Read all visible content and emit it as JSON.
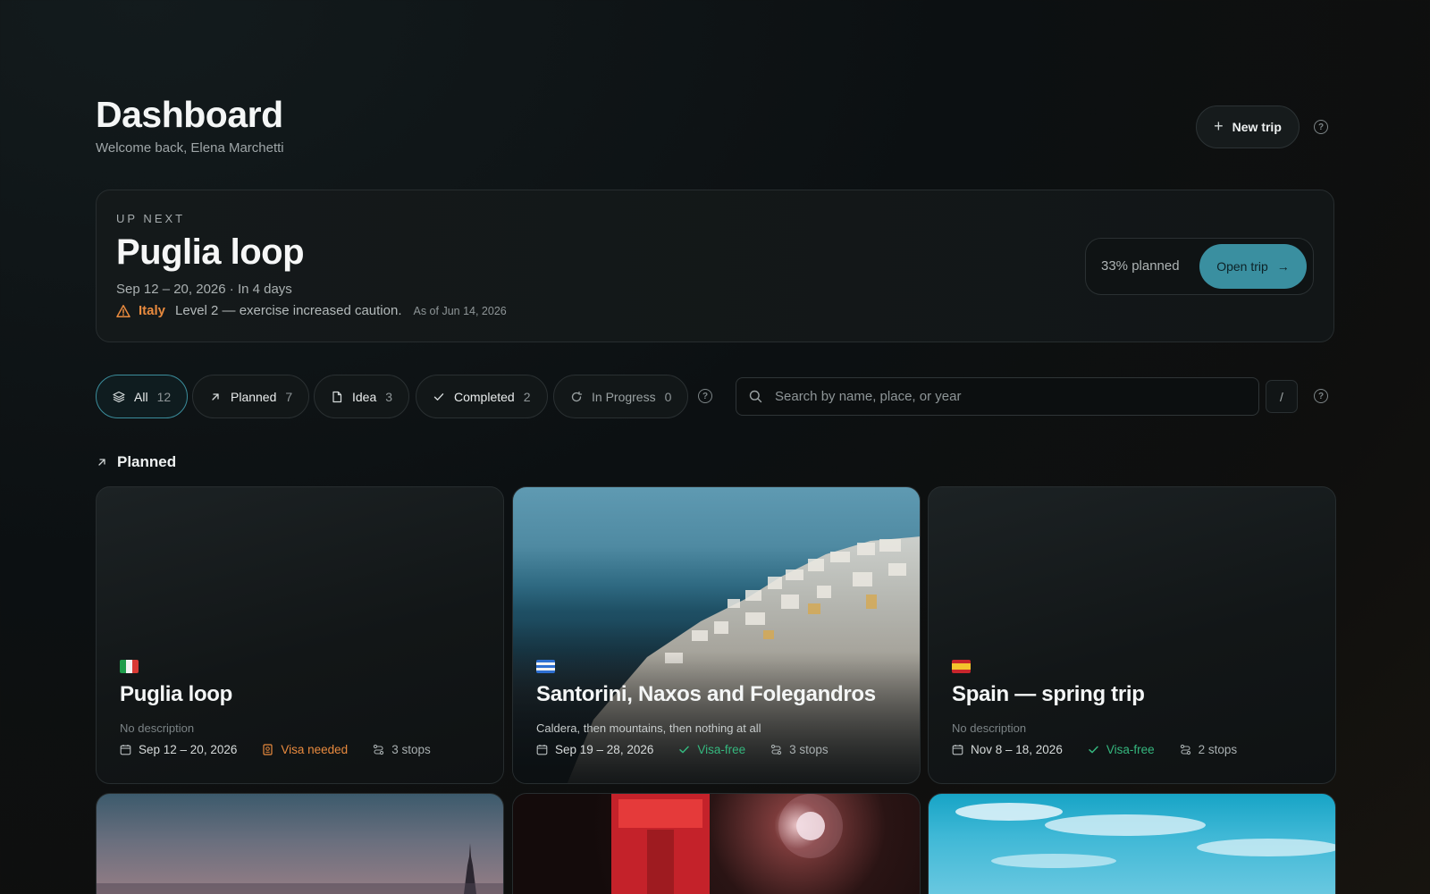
{
  "header": {
    "title": "Dashboard",
    "welcome": "Welcome back, Elena Marchetti",
    "new_trip_label": "New trip",
    "plus_icon": "plus-icon",
    "help_icon": "help-icon"
  },
  "up_next": {
    "label": "UP NEXT",
    "title": "Puglia loop",
    "dates": "Sep 12 – 20, 2026 · In 4 days",
    "advisory": {
      "country": "Italy",
      "level_text": "Level 2 — exercise increased caution.",
      "as_of": "As of Jun 14, 2026",
      "icon": "warning-icon"
    },
    "progress_text": "33% planned",
    "progress_percent": 33,
    "open_trip_label": "Open trip"
  },
  "filters": [
    {
      "label": "All",
      "count": "12",
      "icon": "layers-icon",
      "active": true
    },
    {
      "label": "Planned",
      "count": "7",
      "icon": "arrow-up-right-icon"
    },
    {
      "label": "Idea",
      "count": "3",
      "icon": "document-icon"
    },
    {
      "label": "Completed",
      "count": "2",
      "icon": "check-icon"
    },
    {
      "label": "In Progress",
      "count": "0",
      "icon": "refresh-icon"
    }
  ],
  "search": {
    "placeholder": "Search by name, place, or year",
    "shortcut": "/"
  },
  "section": {
    "title": "Planned"
  },
  "trips": [
    {
      "title": "Puglia loop",
      "description": "No description",
      "dates": "Sep 12 – 20, 2026",
      "visa": "Visa needed",
      "stops": "3 stops",
      "flag": "italy"
    },
    {
      "title": "Santorini, Naxos and Folegandros",
      "description": "Caldera, then mountains, then nothing at all",
      "dates": "Sep 19 – 28, 2026",
      "visa": "Visa-free",
      "stops": "3 stops",
      "flag": "greece"
    },
    {
      "title": "Spain — spring trip",
      "description": "No description",
      "dates": "Nov 8 – 18, 2026",
      "visa": "Visa-free",
      "stops": "2 stops",
      "flag": "spain"
    }
  ],
  "colors": {
    "accent": "#3a8fa0",
    "warning": "#e88a3e",
    "success": "#35b77e",
    "background": "#0d1113"
  }
}
